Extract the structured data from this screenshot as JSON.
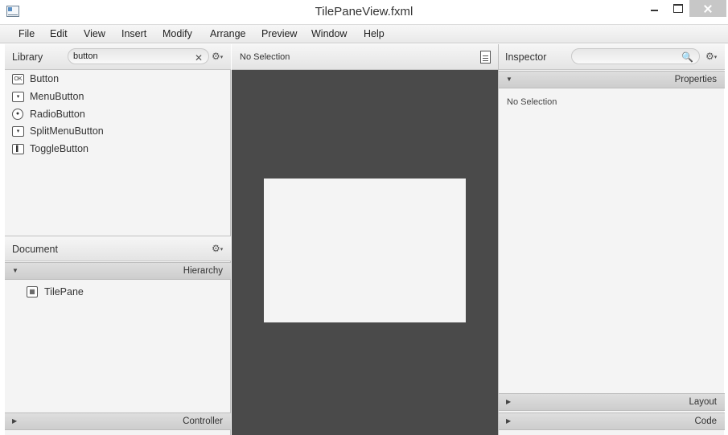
{
  "window": {
    "title": "TilePaneView.fxml"
  },
  "menu": [
    "File",
    "Edit",
    "View",
    "Insert",
    "Modify",
    "Arrange",
    "Preview",
    "Window",
    "Help"
  ],
  "library": {
    "title": "Library",
    "search_value": "button",
    "items": [
      {
        "label": "Button",
        "icon": "button-icon"
      },
      {
        "label": "MenuButton",
        "icon": "menu-button-icon"
      },
      {
        "label": "RadioButton",
        "icon": "radio-button-icon"
      },
      {
        "label": "SplitMenuButton",
        "icon": "split-menu-button-icon"
      },
      {
        "label": "ToggleButton",
        "icon": "toggle-button-icon"
      }
    ]
  },
  "document": {
    "title": "Document",
    "hierarchy_label": "Hierarchy",
    "tree": [
      {
        "label": "TilePane",
        "icon": "tile-pane-icon"
      }
    ],
    "controller_label": "Controller"
  },
  "content": {
    "selection_text": "No Selection"
  },
  "inspector": {
    "title": "Inspector",
    "search_value": "",
    "properties_label": "Properties",
    "no_selection": "No Selection",
    "layout_label": "Layout",
    "code_label": "Code"
  }
}
